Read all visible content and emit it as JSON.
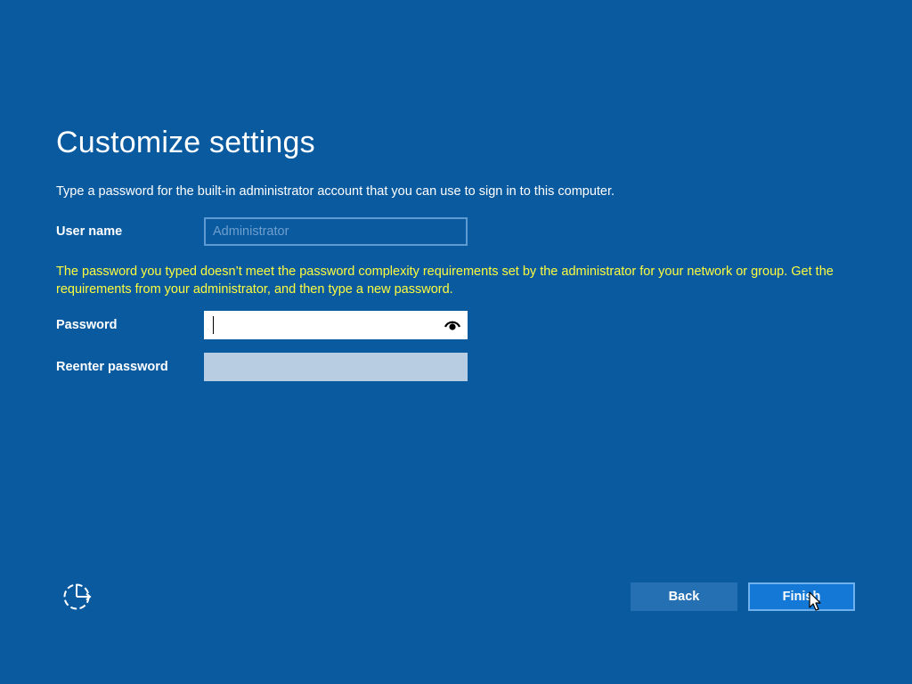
{
  "page": {
    "title": "Customize settings",
    "description": "Type a password for the built-in administrator account that you can use to sign in to this computer."
  },
  "form": {
    "username": {
      "label": "User name",
      "value": "Administrator"
    },
    "warning": "The password you typed doesn’t meet the password complexity requirements set by the administrator for your network or group. Get the requirements from your administrator, and then type a new password.",
    "password": {
      "label": "Password",
      "value": "",
      "reveal_icon": "eye-icon"
    },
    "reenter": {
      "label": "Reenter password",
      "value": ""
    }
  },
  "buttons": {
    "back": "Back",
    "finish": "Finish"
  },
  "icons": {
    "ease_of_access": "ease-of-access-icon",
    "cursor": "mouse-cursor-icon"
  },
  "colors": {
    "background": "#0a5aa0",
    "warning": "#fdfd3e",
    "finish_button": "#1479d6",
    "back_button": "#2470b3"
  }
}
